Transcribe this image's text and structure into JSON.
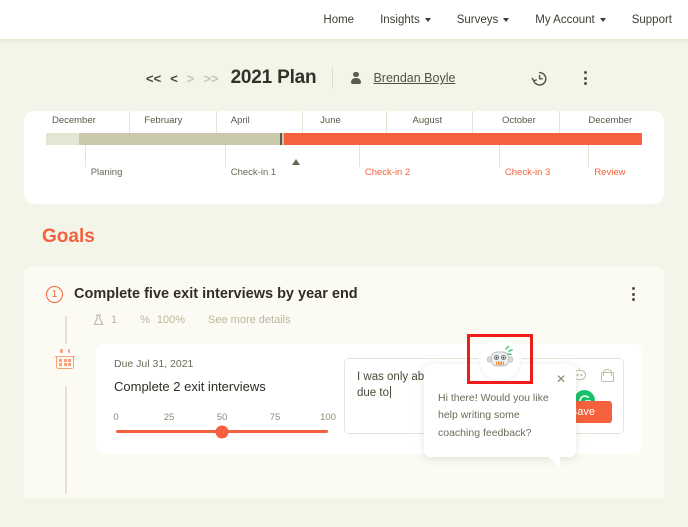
{
  "topnav": {
    "items": [
      {
        "label": "Home",
        "caret": false
      },
      {
        "label": "Insights",
        "caret": true
      },
      {
        "label": "Surveys",
        "caret": true
      },
      {
        "label": "My Account",
        "caret": true
      },
      {
        "label": "Support",
        "caret": false
      }
    ]
  },
  "plan_header": {
    "pager": [
      "<<",
      "<",
      ">",
      ">>"
    ],
    "title": "2021 Plan",
    "person_name": "Brendan Boyle",
    "history_icon": "history-revert-icon",
    "menu_icon": "kebab-menu-icon"
  },
  "timeline": {
    "months": [
      {
        "label": "December",
        "pct": 1
      },
      {
        "label": "February",
        "pct": 16.5
      },
      {
        "label": "April",
        "pct": 31
      },
      {
        "label": "June",
        "pct": 46
      },
      {
        "label": "August",
        "pct": 61.5
      },
      {
        "label": "October",
        "pct": 76.5
      },
      {
        "label": "December",
        "pct": 91
      }
    ],
    "ticks_pct": [
      14,
      28.5,
      43,
      57,
      71.5,
      86
    ],
    "segments": [
      {
        "name": "pre",
        "start_pct": 0,
        "end_pct": 5.5,
        "color": "#e4e6d4"
      },
      {
        "name": "past",
        "start_pct": 5.5,
        "end_pct": 39.2,
        "color": "#c9c8ac"
      },
      {
        "name": "future",
        "start_pct": 40,
        "end_pct": 100,
        "color": "#f4613c"
      }
    ],
    "marker_pct": 39.3,
    "today_pct": 42,
    "milestones": [
      {
        "label": "Planing",
        "pct": 6.5,
        "color": "#6b6756",
        "done": true
      },
      {
        "label": "Check-in 1",
        "pct": 30,
        "color": "#6b6756",
        "done": true
      },
      {
        "label": "Check-in 2",
        "pct": 52.5,
        "color": "#f4613c",
        "done": false
      },
      {
        "label": "Check-in 3",
        "pct": 76,
        "color": "#f4613c",
        "done": false
      },
      {
        "label": "Review",
        "pct": 91,
        "color": "#f4613c",
        "done": false
      }
    ]
  },
  "goals": {
    "section_title": "Goals",
    "goal": {
      "number": "1",
      "title": "Complete five exit interviews by year end",
      "meta": {
        "flask_icon": "flask-icon",
        "weight_value": "1",
        "percent_symbol": "%",
        "percent_value": "100%",
        "details_link": "See more details"
      },
      "menu_icon": "kebab-menu-icon"
    }
  },
  "milestone": {
    "calendar_icon": "calendar-icon",
    "due": "Due Jul 31, 2021",
    "name": "Complete 2 exit interviews",
    "slider": {
      "ticks": [
        "0",
        "25",
        "50",
        "75",
        "100"
      ],
      "value": 50,
      "min": 0,
      "max": 100
    }
  },
  "comment": {
    "text": "I was only able to complete one due to",
    "bot_icon": "bot-assistant-icon",
    "lock_icon": "lock-icon",
    "grammarly_icon": "grammarly-icon",
    "save_label": "Save"
  },
  "bot_popover": {
    "message": "Hi there! Would you like help writing some coaching feedback?",
    "close_icon": "close-icon",
    "avatar_icon": "robot-avatar-icon",
    "highlight_color": "#ef1c1c"
  },
  "colors": {
    "accent_orange": "#f4613c",
    "page_bg": "#f4f5e9",
    "card_bg": "#ffffff",
    "muted": "#b9b69c",
    "timeline_past": "#c9c8ac",
    "grammarly_green": "#15c26b"
  }
}
